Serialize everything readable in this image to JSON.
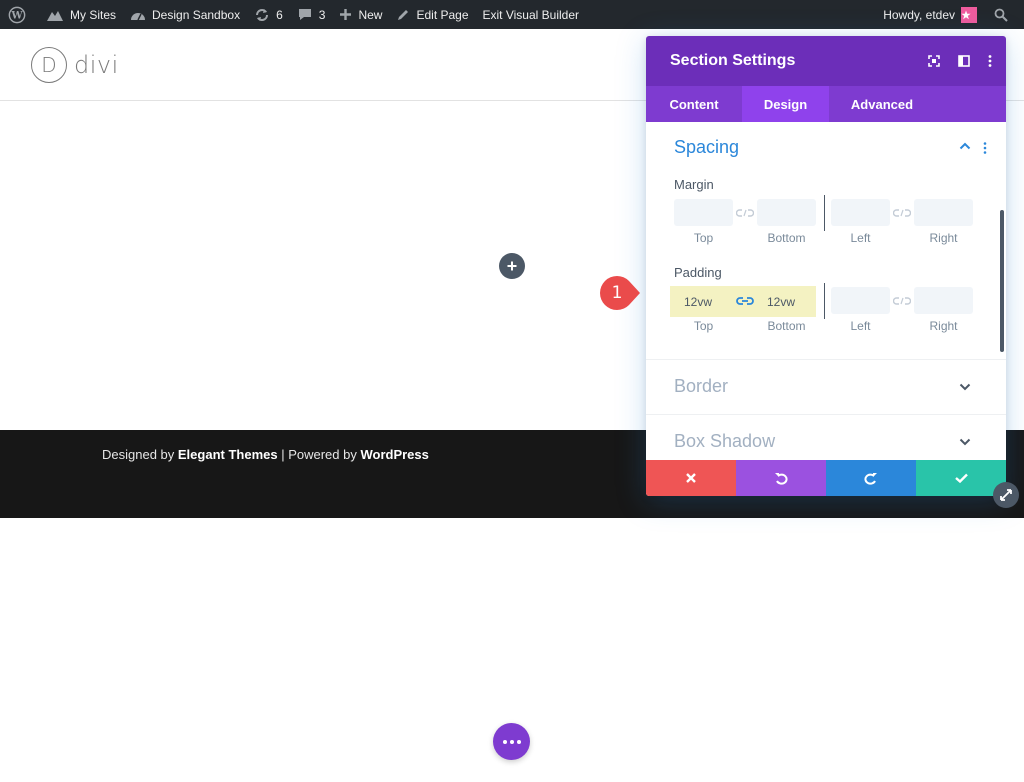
{
  "adminbar": {
    "my_sites": "My Sites",
    "site_name": "Design Sandbox",
    "updates_count": "6",
    "comments_count": "3",
    "new_label": "New",
    "edit_page": "Edit Page",
    "exit_builder": "Exit Visual Builder",
    "howdy": "Howdy, etdev"
  },
  "header": {
    "logo_letter": "D",
    "logo_text": "divi"
  },
  "footer": {
    "prefix": "Designed by ",
    "brand": "Elegant Themes",
    "mid": " | Powered by ",
    "platform": "WordPress"
  },
  "modal": {
    "title": "Section Settings",
    "tabs": [
      {
        "label": "Content"
      },
      {
        "label": "Design"
      },
      {
        "label": "Advanced"
      }
    ],
    "spacing": {
      "title": "Spacing",
      "margin_label": "Margin",
      "padding_label": "Padding",
      "sub_labels": [
        "Top",
        "Bottom",
        "Left",
        "Right"
      ],
      "padding_top": "12vw",
      "padding_bottom": "12vw"
    },
    "border_title": "Border",
    "box_shadow_title": "Box Shadow"
  },
  "callout": {
    "number": "1"
  },
  "colors": {
    "accent": "#2b87da",
    "header_purple": "#6c2eb9",
    "tab_purple": "#7e3bd0",
    "cancel": "#ef5555",
    "undo": "#9b51e0",
    "redo": "#2b87da",
    "save": "#29c4a9",
    "highlight": "#f4f2c2"
  }
}
